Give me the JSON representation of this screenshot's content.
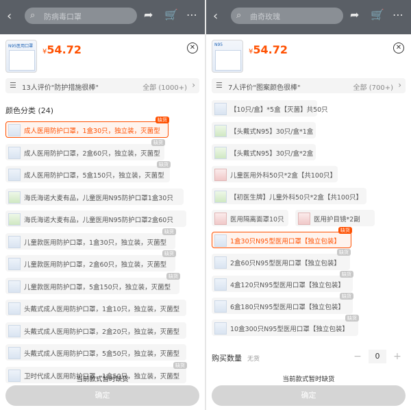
{
  "left": {
    "topbar": {
      "search_placeholder": "防病毒口罩",
      "cart_badge": ""
    },
    "sku": {
      "thumb_label": "N95医用口罩",
      "currency": "¥",
      "price": "54.72",
      "review_text": "13人评价\"防护措施很棒\"",
      "review_all": "全部 (1000+)",
      "section_title": "颜色分类 (24)",
      "options": [
        {
          "label": "成人医用防护口罩，1盒30只，独立装，灭菌型",
          "tag": "缺货",
          "selected": true,
          "img": "blue"
        },
        {
          "label": "成人医用防护口罩，2盒60只，独立装，灭菌型",
          "tag": "缺货",
          "img": "blue"
        },
        {
          "label": "成人医用防护口罩，5盒150只，独立装，灭菌型",
          "tag": "缺货",
          "img": "blue"
        },
        {
          "label": "海氏海诺大麦有品，儿童医用N95防护口罩1盒30只",
          "tag": "",
          "img": "green"
        },
        {
          "label": "海氏海诺大麦有品，儿童医用N95防护口罩2盒60只",
          "tag": "",
          "img": "green"
        },
        {
          "label": "儿童款医用防护口罩，1盒30只，独立装，灭菌型",
          "tag": "缺货",
          "img": "blue"
        },
        {
          "label": "儿童款医用防护口罩，2盒60只，独立装，灭菌型",
          "tag": "缺货",
          "img": "blue"
        },
        {
          "label": "儿童款医用防护口罩，5盒150只，独立装，灭菌型",
          "tag": "缺货",
          "img": "blue"
        },
        {
          "label": "头戴式成人医用防护口罩，1盒10只，独立装，灭菌型",
          "tag": "",
          "img": "blue"
        },
        {
          "label": "头戴式成人医用防护口罩，2盒20只，独立装，灭菌型",
          "tag": "",
          "img": "blue"
        },
        {
          "label": "头戴式成人医用防护口罩，5盒50只，独立装，灭菌型",
          "tag": "",
          "img": "blue"
        },
        {
          "label": "卫时代成人医用防护口罩，1盒50只，独立装，灭菌型",
          "tag": "缺货",
          "img": "blue"
        }
      ],
      "notice": "当前款式暂时缺货",
      "confirm": "确定"
    }
  },
  "right": {
    "topbar": {
      "search_placeholder": "曲奇玫瑰",
      "cart_badge": ""
    },
    "sku": {
      "thumb_label": "N95",
      "currency": "¥",
      "price": "54.72",
      "review_text": "7人评价\"图案颜色很棒\"",
      "review_all": "全部 (700+)",
      "options": [
        {
          "label": "【10只/盒】*5盒【灭菌】共50只",
          "tag": "",
          "img": "blue"
        },
        {
          "label": "【头戴式N95】30只/盒*1盒",
          "tag": "",
          "img": "green"
        },
        {
          "label": "【头戴式N95】30只/盒*2盒",
          "tag": "",
          "img": "green"
        },
        {
          "label": "儿童医用外科50只*2盒【共100只】",
          "tag": "",
          "img": "red"
        },
        {
          "label": "【初医生牌】儿童外科50只*2盒【共100只】",
          "tag": "",
          "img": "green"
        },
        {
          "label": "医用隔离面罩10只",
          "tag": "",
          "img": "red"
        },
        {
          "label": "医用护目镜*2副",
          "tag": "",
          "img": "red"
        },
        {
          "label": "1盒30只N95型医用口罩【独立包装】",
          "tag": "缺货",
          "selected": true,
          "img": "blue"
        },
        {
          "label": "2盒60只N95型医用口罩【独立包装】",
          "tag": "缺货",
          "img": "blue"
        },
        {
          "label": "4盒120只N95型医用口罩【独立包装】",
          "tag": "缺货",
          "img": "blue"
        },
        {
          "label": "6盒180只N95型医用口罩【独立包装】",
          "tag": "缺货",
          "img": "blue"
        },
        {
          "label": "10盒300只N95型医用口罩【独立包装】",
          "tag": "缺货",
          "img": "blue"
        }
      ],
      "qty_label": "购买数量",
      "qty_status": "无货",
      "qty_value": "0",
      "notice": "当前款式暂时缺货",
      "confirm": "确定"
    }
  }
}
